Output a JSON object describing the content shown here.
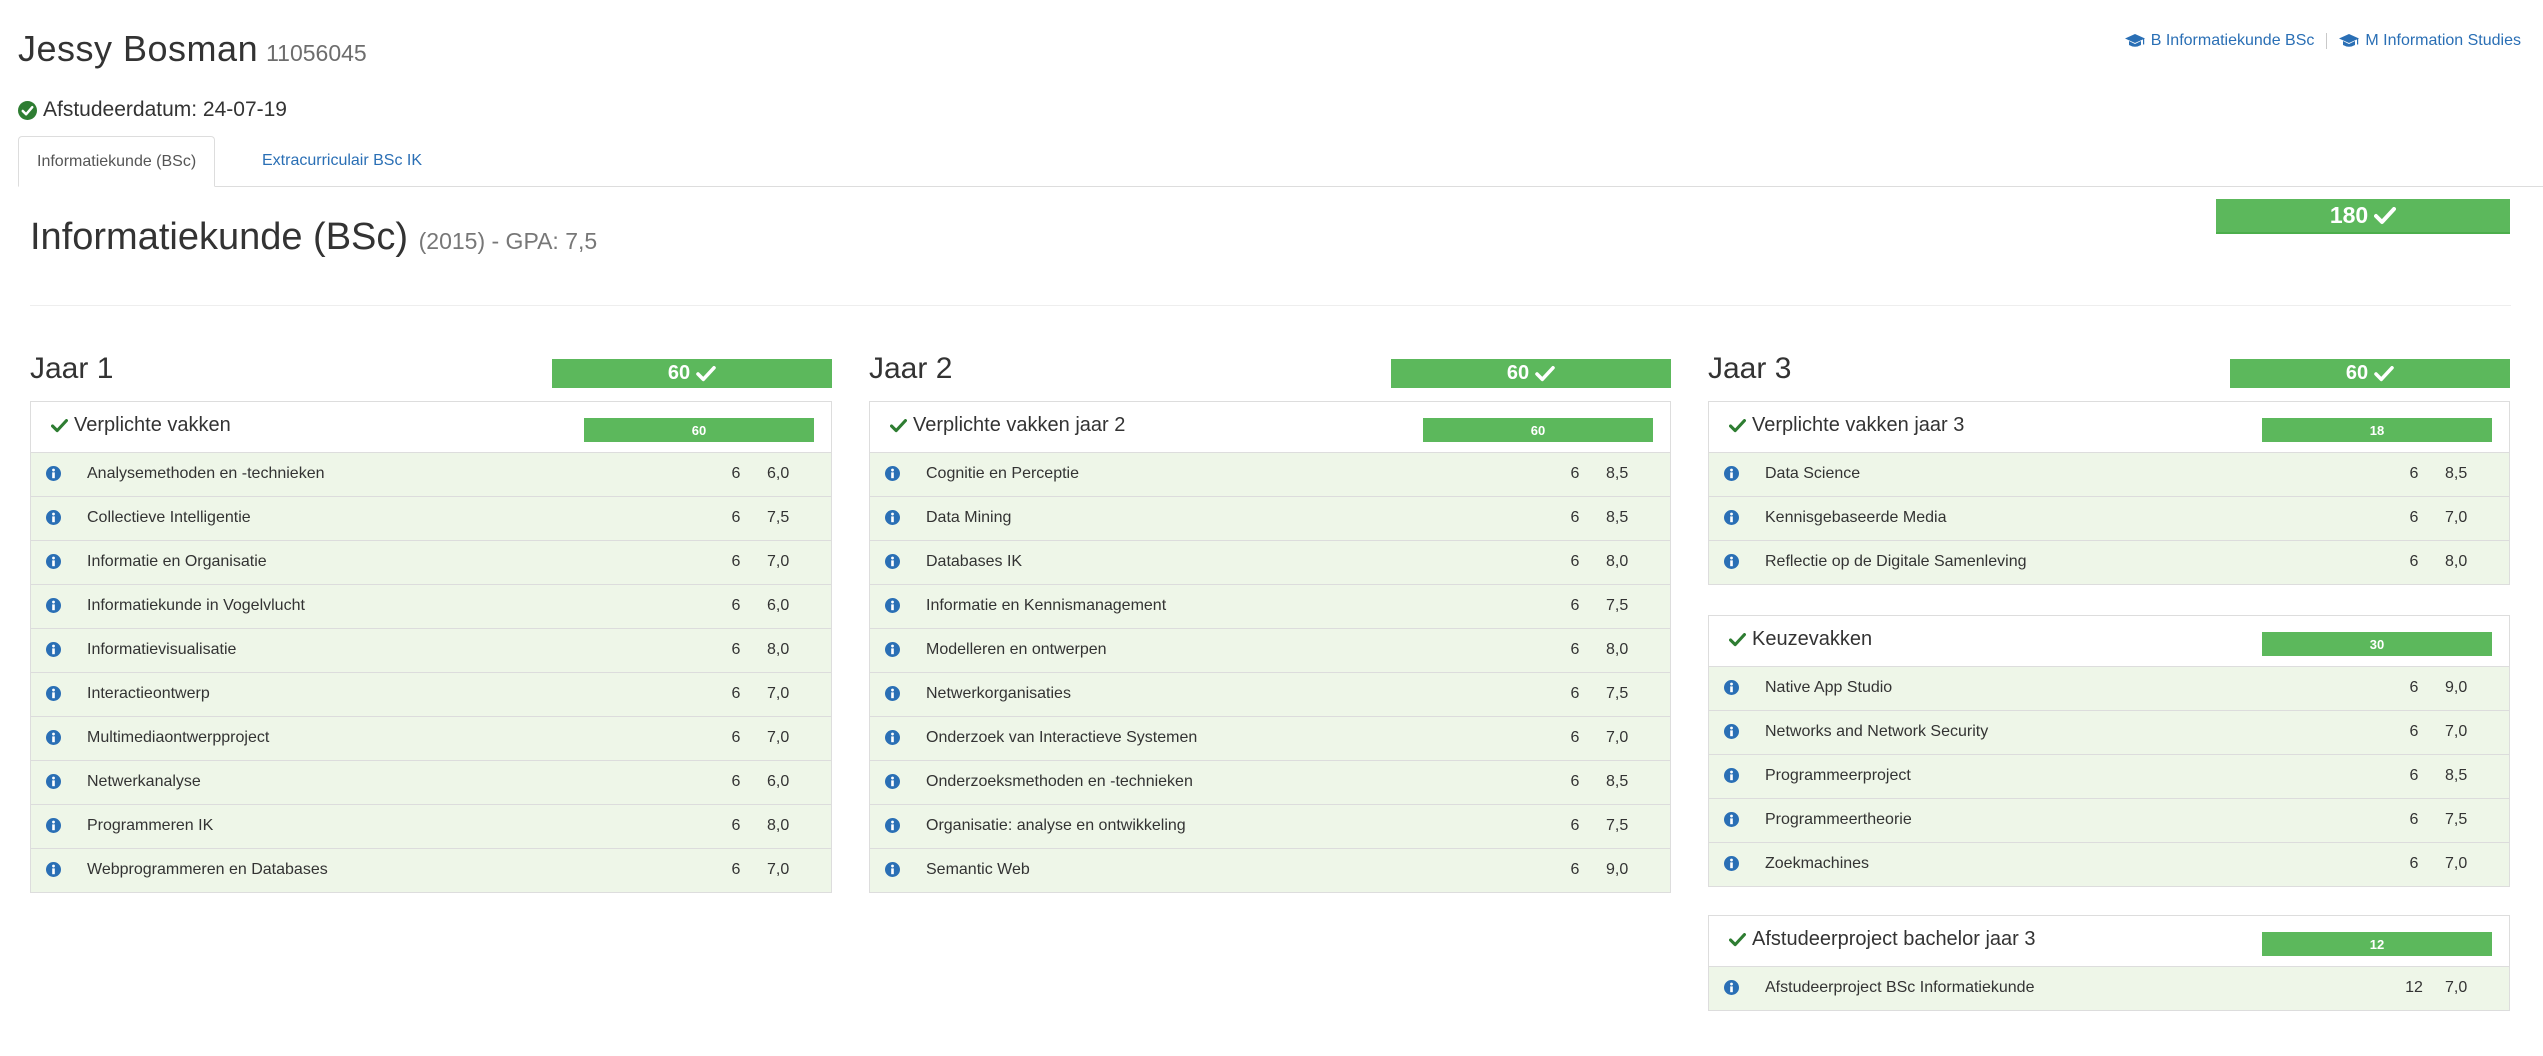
{
  "student": {
    "name": "Jessy Bosman",
    "id": "11056045",
    "graduation": "Afstudeerdatum: 24-07-19"
  },
  "program_links": [
    {
      "label": "B Informatiekunde BSc",
      "icon": "graduation-cap-icon"
    },
    {
      "label": "M Information Studies",
      "icon": "graduation-cap-icon"
    }
  ],
  "tabs": [
    {
      "label": "Informatiekunde (BSc)",
      "active": true
    },
    {
      "label": "Extracurriculair BSc IK",
      "active": false
    }
  ],
  "program": {
    "title": "Informatiekunde (BSc)",
    "meta": "(2015) - GPA: 7,5",
    "total_ec": "180"
  },
  "colors": {
    "success": "#5cb85c",
    "row_bg": "#eef6e8",
    "link": "#2a6fb5",
    "check": "#2e7d32"
  },
  "years": [
    {
      "title": "Jaar 1",
      "ec": "60",
      "panels": [
        {
          "title": "Verplichte vakken",
          "ec": "60",
          "courses": [
            {
              "name": "Analysemethoden en -technieken",
              "ec": "6",
              "grade": "6,0"
            },
            {
              "name": "Collectieve Intelligentie",
              "ec": "6",
              "grade": "7,5"
            },
            {
              "name": "Informatie en Organisatie",
              "ec": "6",
              "grade": "7,0"
            },
            {
              "name": "Informatiekunde in Vogelvlucht",
              "ec": "6",
              "grade": "6,0"
            },
            {
              "name": "Informatievisualisatie",
              "ec": "6",
              "grade": "8,0"
            },
            {
              "name": "Interactieontwerp",
              "ec": "6",
              "grade": "7,0"
            },
            {
              "name": "Multimediaontwerpproject",
              "ec": "6",
              "grade": "7,0"
            },
            {
              "name": "Netwerkanalyse",
              "ec": "6",
              "grade": "6,0"
            },
            {
              "name": "Programmeren IK",
              "ec": "6",
              "grade": "8,0"
            },
            {
              "name": "Webprogrammeren en Databases",
              "ec": "6",
              "grade": "7,0"
            }
          ]
        }
      ]
    },
    {
      "title": "Jaar 2",
      "ec": "60",
      "panels": [
        {
          "title": "Verplichte vakken jaar 2",
          "ec": "60",
          "courses": [
            {
              "name": "Cognitie en Perceptie",
              "ec": "6",
              "grade": "8,5"
            },
            {
              "name": "Data Mining",
              "ec": "6",
              "grade": "8,5"
            },
            {
              "name": "Databases IK",
              "ec": "6",
              "grade": "8,0"
            },
            {
              "name": "Informatie en Kennismanagement",
              "ec": "6",
              "grade": "7,5"
            },
            {
              "name": "Modelleren en ontwerpen",
              "ec": "6",
              "grade": "8,0"
            },
            {
              "name": "Netwerkorganisaties",
              "ec": "6",
              "grade": "7,5"
            },
            {
              "name": "Onderzoek van Interactieve Systemen",
              "ec": "6",
              "grade": "7,0"
            },
            {
              "name": "Onderzoeksmethoden en -technieken",
              "ec": "6",
              "grade": "8,5"
            },
            {
              "name": "Organisatie: analyse en ontwikkeling",
              "ec": "6",
              "grade": "7,5"
            },
            {
              "name": "Semantic Web",
              "ec": "6",
              "grade": "9,0"
            }
          ]
        }
      ]
    },
    {
      "title": "Jaar 3",
      "ec": "60",
      "panels": [
        {
          "title": "Verplichte vakken jaar 3",
          "ec": "18",
          "courses": [
            {
              "name": "Data Science",
              "ec": "6",
              "grade": "8,5"
            },
            {
              "name": "Kennisgebaseerde Media",
              "ec": "6",
              "grade": "7,0"
            },
            {
              "name": "Reflectie op de Digitale Samenleving",
              "ec": "6",
              "grade": "8,0"
            }
          ]
        },
        {
          "title": "Keuzevakken",
          "ec": "30",
          "courses": [
            {
              "name": "Native App Studio",
              "ec": "6",
              "grade": "9,0"
            },
            {
              "name": "Networks and Network Security",
              "ec": "6",
              "grade": "7,0"
            },
            {
              "name": "Programmeerproject",
              "ec": "6",
              "grade": "8,5"
            },
            {
              "name": "Programmeertheorie",
              "ec": "6",
              "grade": "7,5"
            },
            {
              "name": "Zoekmachines",
              "ec": "6",
              "grade": "7,0"
            }
          ]
        },
        {
          "title": "Afstudeerproject bachelor jaar 3",
          "ec": "12",
          "courses": [
            {
              "name": "Afstudeerproject BSc Informatiekunde",
              "ec": "12",
              "grade": "7,0"
            }
          ]
        }
      ]
    }
  ]
}
